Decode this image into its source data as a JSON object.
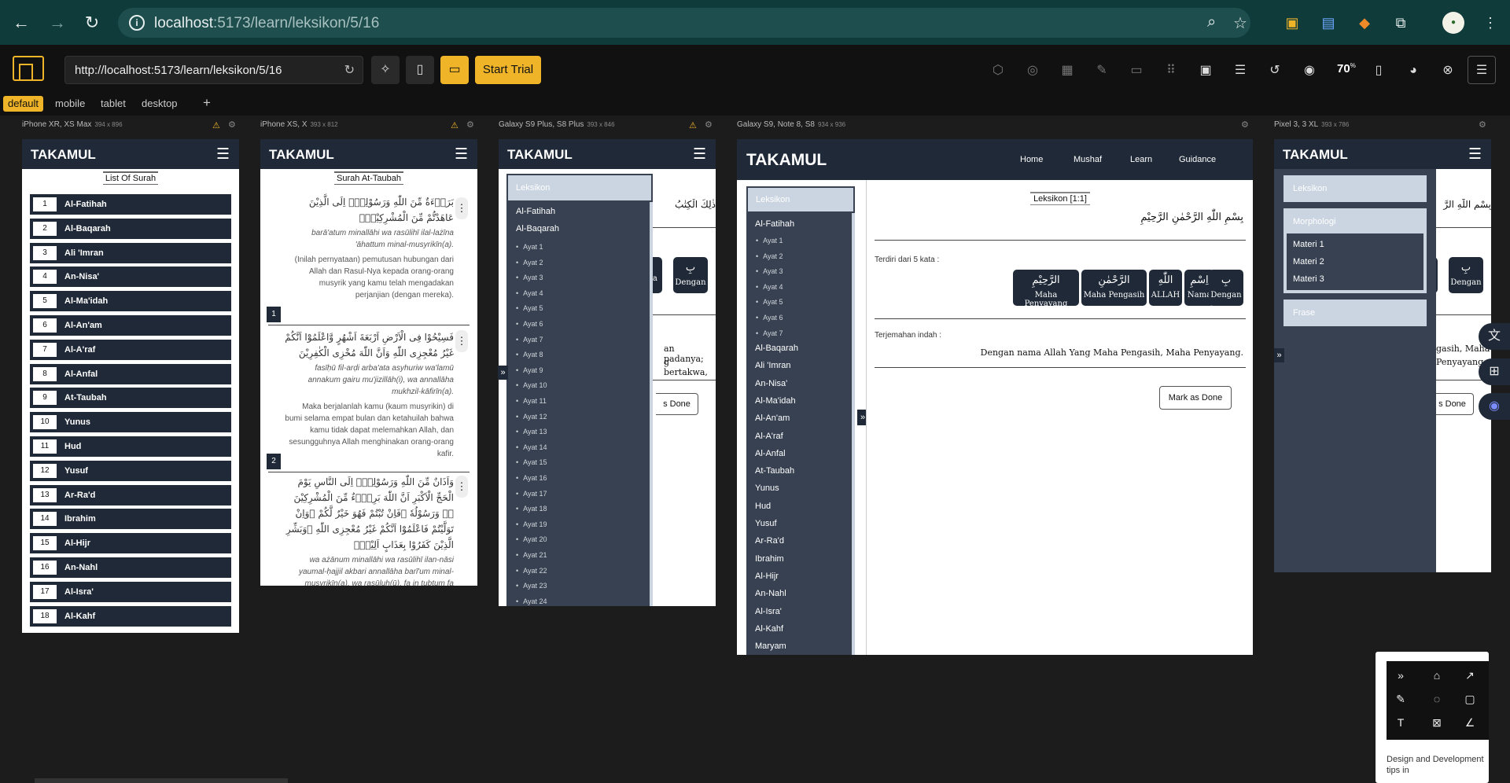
{
  "browser": {
    "url_host": "localhost",
    "url_rest": ":5173/learn/leksikon/5/16"
  },
  "toolbar": {
    "url": "http://localhost:5173/learn/leksikon/5/16",
    "start_trial": "Start Trial",
    "zoom": "70",
    "zoom_unit": "%"
  },
  "tabs": [
    "default",
    "mobile",
    "tablet",
    "desktop"
  ],
  "devices": [
    {
      "name": "iPhone XR, XS Max",
      "size": "394 x 896"
    },
    {
      "name": "iPhone XS, X",
      "size": "393 x 812"
    },
    {
      "name": "Galaxy S9 Plus, S8 Plus",
      "size": "393 x 846"
    },
    {
      "name": "Galaxy S9, Note 8, S8",
      "size": "934 x 936"
    },
    {
      "name": "Pixel 3, 3 XL",
      "size": "393 x 786"
    }
  ],
  "app": {
    "logo": "TAKAMUL",
    "nav": [
      "Home",
      "Mushaf",
      "Learn",
      "Guidance"
    ]
  },
  "phone1": {
    "title": "List Of Surah",
    "surahs": [
      {
        "n": "1",
        "name": "Al-Fatihah"
      },
      {
        "n": "2",
        "name": "Al-Baqarah"
      },
      {
        "n": "3",
        "name": "Ali 'Imran"
      },
      {
        "n": "4",
        "name": "An-Nisa'"
      },
      {
        "n": "5",
        "name": "Al-Ma'idah"
      },
      {
        "n": "6",
        "name": "Al-An'am"
      },
      {
        "n": "7",
        "name": "Al-A'raf"
      },
      {
        "n": "8",
        "name": "Al-Anfal"
      },
      {
        "n": "9",
        "name": "At-Taubah"
      },
      {
        "n": "10",
        "name": "Yunus"
      },
      {
        "n": "11",
        "name": "Hud"
      },
      {
        "n": "12",
        "name": "Yusuf"
      },
      {
        "n": "13",
        "name": "Ar-Ra'd"
      },
      {
        "n": "14",
        "name": "Ibrahim"
      },
      {
        "n": "15",
        "name": "Al-Hijr"
      },
      {
        "n": "16",
        "name": "An-Nahl"
      },
      {
        "n": "17",
        "name": "Al-Isra'"
      },
      {
        "n": "18",
        "name": "Al-Kahf"
      }
    ]
  },
  "phone2": {
    "title": "Surah At-Taubah",
    "ayat": [
      {
        "ar": "بَرَاۤءَةٌ مِّنَ اللّٰهِ وَرَسُوْلِهٖٓ اِلَى الَّذِيْنَ عَاهَدْتُّمْ مِّنَ الْمُشْرِكِيْنَۗ",
        "tr": "barā'atum minallāhi wa rasūlihī ilal-lażīna 'āhattum minal-musyrikīn(a).",
        "id": "(Inilah pernyataan) pemutusan hubungan dari Allah dan Rasul-Nya kepada orang-orang musyrik yang kamu telah mengadakan perjanjian (dengan mereka).",
        "num": "1"
      },
      {
        "ar": "فَسِيْحُوْا فِى الْاَرْضِ اَرْبَعَةَ اَشْهُرٍ وَّاعْلَمُوْٓا اَنَّكُمْ غَيْرُ مُعْجِزِى اللّٰهِ وَاَنَّ اللّٰهَ مُخْزِى الْكٰفِرِيْنَ",
        "tr": "fasīḥū fil-arḍi arba'ata asyhuriw wa'lamū annakum gairu mu'jizillāh(i), wa annallāha mukhzil-kāfirīn(a).",
        "id": "Maka berjalanlah kamu (kaum musyrikin) di bumi selama empat bulan dan ketahuilah bahwa kamu tidak dapat melemahkan Allah, dan sesungguhnya Allah menghinakan orang-orang kafir.",
        "num": "2"
      },
      {
        "ar": "وَاَذَانٌ مِّنَ اللّٰهِ وَرَسُوْلِهٖٓ اِلَى النَّاسِ يَوْمَ الْحَجِّ الْاَكْبَرِ اَنَّ اللّٰهَ بَرِيْۤءٌ مِّنَ الْمُشْرِكِيْنَ ەۙ وَرَسُوْلُهٗ ۗفَاِنْ تُبْتُمْ فَهُوَ خَيْرٌ لَّكُمْ ۚوَاِنْ تَوَلَّيْتُمْ فَاعْلَمُوْٓا اَنَّكُمْ غَيْرُ مُعْجِزِى اللّٰهِ ۗوَبَشِّرِ الَّذِيْنَ كَفَرُوْا بِعَذَابٍ اَلِيْمٍۙ",
        "tr": "wa ażānum minallāhi wa rasūlihī ilan-nāsi yaumal-ḥajjil akbari annallāha barī'um minal-musyrikīn(a), wa rasūluh(ū), fa in tubtum fa huwa khairul"
      }
    ]
  },
  "phone3": {
    "panel_head": "Leksikon",
    "surah1": "Al-Fatihah",
    "surah2": "Al-Baqarah",
    "ayat": [
      "Ayat 1",
      "Ayat 2",
      "Ayat 3",
      "Ayat 4",
      "Ayat 5",
      "Ayat 6",
      "Ayat 7",
      "Ayat 8",
      "Ayat 9",
      "Ayat 10",
      "Ayat 11",
      "Ayat 12",
      "Ayat 13",
      "Ayat 14",
      "Ayat 15",
      "Ayat 16",
      "Ayat 17",
      "Ayat 18",
      "Ayat 19",
      "Ayat 20",
      "Ayat 21",
      "Ayat 22",
      "Ayat 23",
      "Ayat 24"
    ],
    "peek_ar": "ذٰلِكَ الْكِتٰبُ",
    "peek_word": "Dengan",
    "peek_word_ar": "بِ",
    "peek_a": "a",
    "peek_text1": "an padanya;",
    "peek_text2": "g bertakwa,",
    "peek_done": "s Done"
  },
  "tablet": {
    "panel_head": "Leksikon",
    "fatihah": "Al-Fatihah",
    "ayat": [
      "Ayat 1",
      "Ayat 2",
      "Ayat 3",
      "Ayat 4",
      "Ayat 5",
      "Ayat 6",
      "Ayat 7"
    ],
    "surahs": [
      "Al-Baqarah",
      "Ali 'Imran",
      "An-Nisa'",
      "Al-Ma'idah",
      "Al-An'am",
      "Al-A'raf",
      "Al-Anfal",
      "At-Taubah",
      "Yunus",
      "Hud",
      "Yusuf",
      "Ar-Ra'd",
      "Ibrahim",
      "Al-Hijr",
      "An-Nahl",
      "Al-Isra'",
      "Al-Kahf",
      "Maryam"
    ],
    "heading": "Leksikon [1:1]",
    "basmalah": "بِسْمِ اللّٰهِ الرَّحْمٰنِ الرَّحِيْمِ",
    "words_label": "Terdiri dari 5 kata :",
    "words": [
      {
        "ar": "الرَّحِيْمِ",
        "tr": "Maha Penyayang"
      },
      {
        "ar": "الرَّحْمٰنِ",
        "tr": "Maha Pengasih"
      },
      {
        "ar": "اللّٰهِ",
        "tr": "ALLAH"
      },
      {
        "ar": "اِسْمِ",
        "tr": "Nama"
      },
      {
        "ar": "بِ",
        "tr": "Dengan"
      }
    ],
    "translation_label": "Terjemahan indah :",
    "translation": "Dengan nama Allah Yang Maha Pengasih, Maha Penyayang.",
    "mark_done": "Mark as Done",
    "toggle": "»"
  },
  "pixel": {
    "leksikon": "Leksikon",
    "morphologi": "Morphologi",
    "materi": [
      "Materi 1",
      "Materi 2",
      "Materi 3"
    ],
    "frase": "Frase",
    "peek_ar": "بِسْمِ اللّٰهِ الرَّ",
    "peek_word": "Dengan",
    "peek_word_ar": "بِ",
    "peek_a": "a",
    "peek_text1": "gasih, Maha",
    "peek_text2": "Penyayang",
    "peek_done": "s Done"
  },
  "widget": {
    "text": "Design and Development tips in"
  }
}
